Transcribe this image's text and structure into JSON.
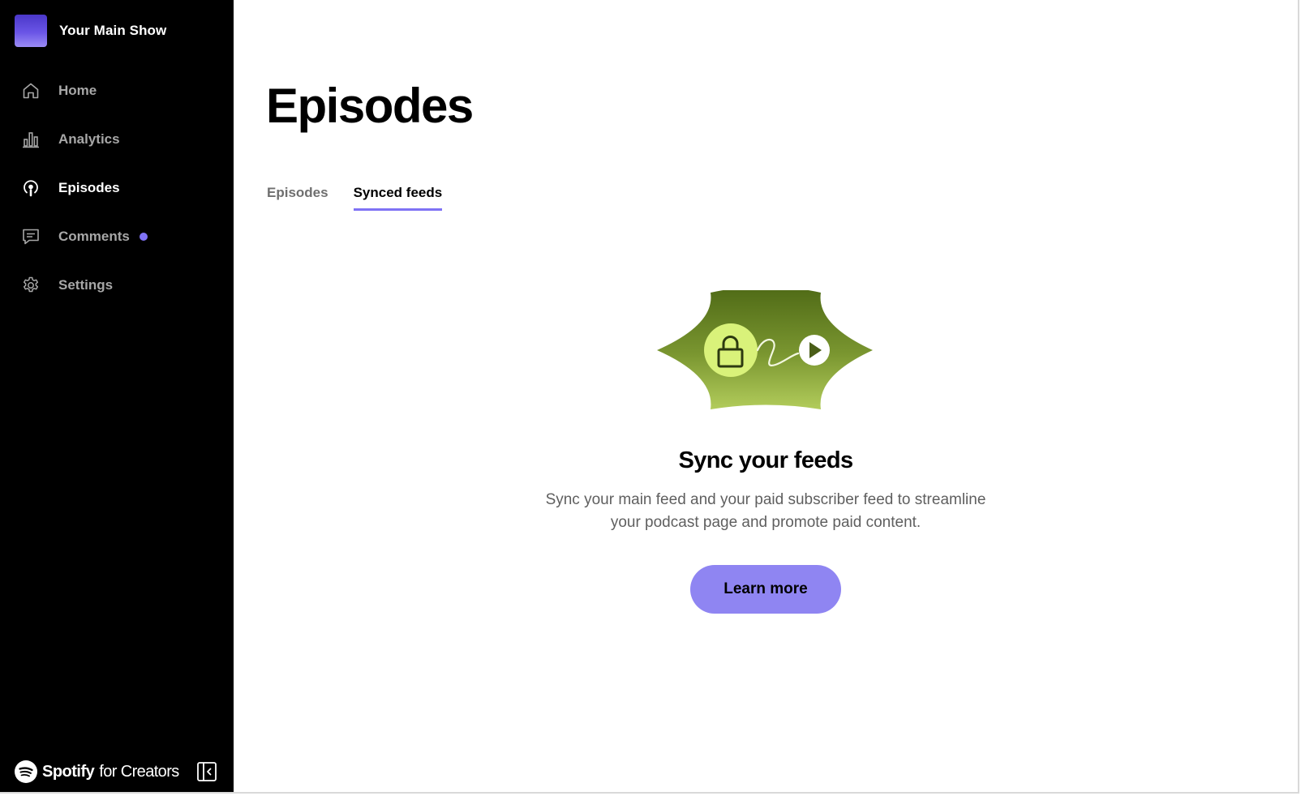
{
  "show": {
    "name": "Your Main Show"
  },
  "sidebar": {
    "items": [
      {
        "label": "Home",
        "icon": "home-icon",
        "active": false
      },
      {
        "label": "Analytics",
        "icon": "bar-chart-icon",
        "active": false
      },
      {
        "label": "Episodes",
        "icon": "podcast-icon",
        "active": true
      },
      {
        "label": "Comments",
        "icon": "comment-icon",
        "active": false,
        "has_badge": true
      },
      {
        "label": "Settings",
        "icon": "gear-icon",
        "active": false
      }
    ]
  },
  "footer": {
    "brand_name": "Spotify",
    "brand_suffix": "for Creators"
  },
  "main": {
    "title": "Episodes",
    "tabs": [
      {
        "label": "Episodes",
        "active": false
      },
      {
        "label": "Synced feeds",
        "active": true
      }
    ],
    "empty_state": {
      "title": "Sync your feeds",
      "description": "Sync your main feed and your paid subscriber feed to streamline your podcast page and promote paid content.",
      "button_label": "Learn more"
    }
  },
  "colors": {
    "sidebar_bg": "#000000",
    "accent": "#8f85f2",
    "badge": "#7f72f5",
    "illustration_green": "#7a9630"
  }
}
